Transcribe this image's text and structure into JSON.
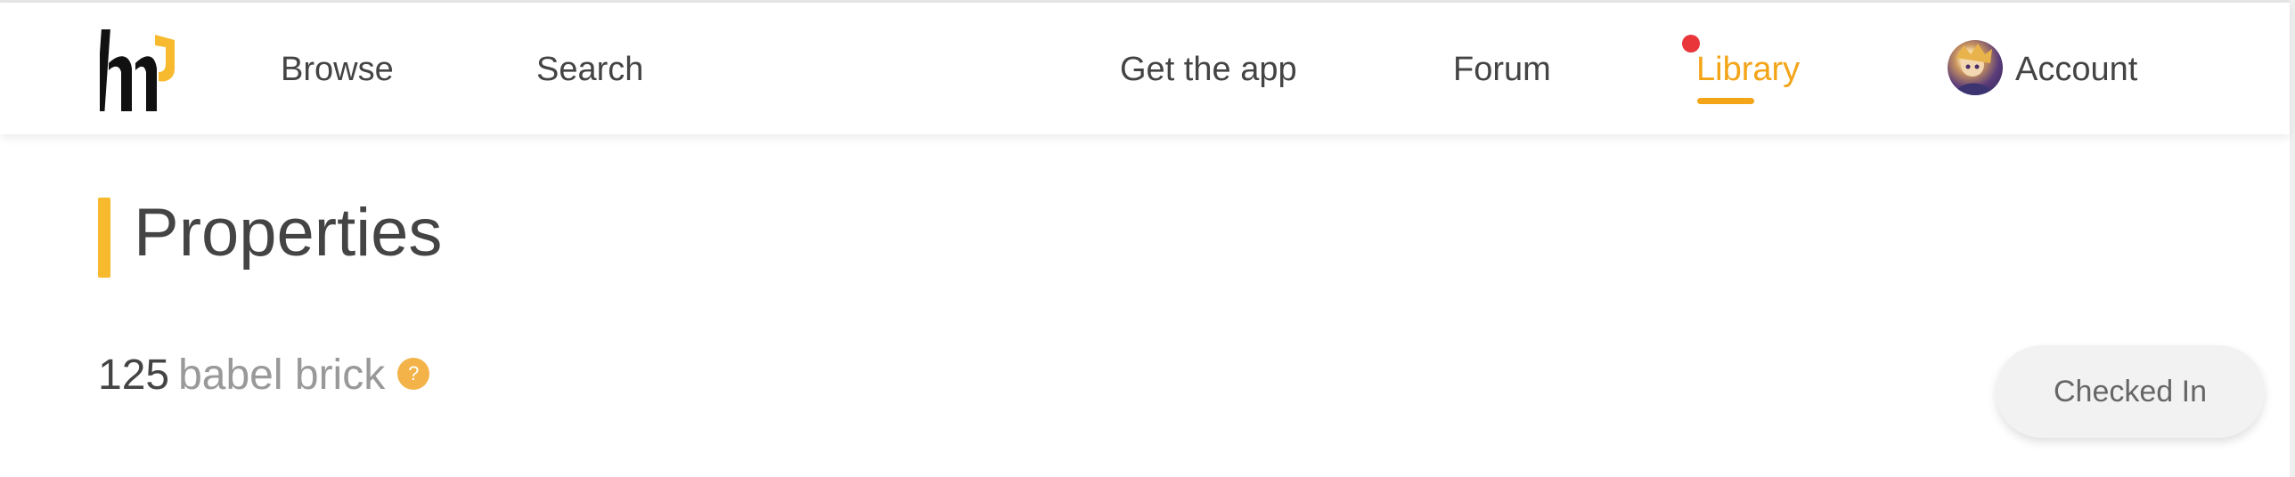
{
  "nav": {
    "browse_label": "Browse",
    "search_label": "Search",
    "get_app_label": "Get the app",
    "forum_label": "Forum",
    "library_label": "Library",
    "account_label": "Account",
    "active_item": "Library",
    "has_notification": true
  },
  "icons": {
    "logo": "brand-logo",
    "avatar": "user-avatar",
    "notification": "red-dot",
    "help": "question-mark-circle"
  },
  "page": {
    "title": "Properties"
  },
  "properties": {
    "brick_count": "125",
    "brick_unit": "babel brick",
    "help_symbol": "?",
    "checkin_label": "Checked In"
  },
  "colors": {
    "accent": "#f3a417",
    "title_bar": "#f7b92d",
    "notification_dot": "#e8363b",
    "help_icon": "#f3b349",
    "text_primary": "#444444",
    "text_muted": "#999999"
  }
}
